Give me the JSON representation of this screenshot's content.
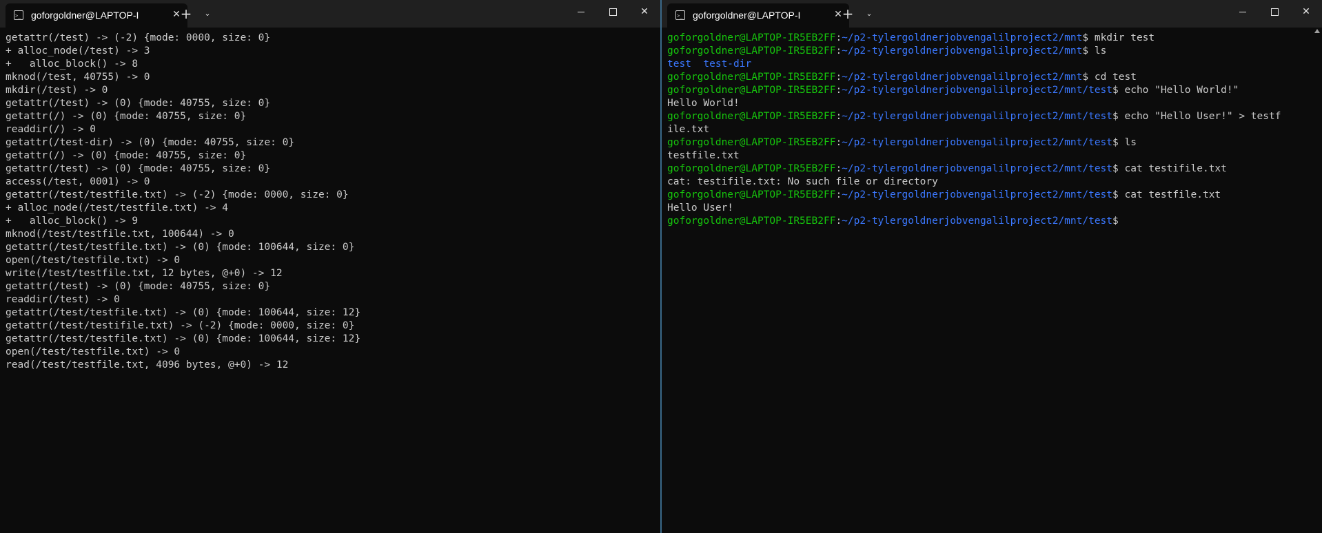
{
  "left_window": {
    "tab_title": "goforgoldner@LAPTOP-I",
    "lines": [
      "getattr(/test) -> (-2) {mode: 0000, size: 0}",
      "+ alloc_node(/test) -> 3",
      "+   alloc_block() -> 8",
      "mknod(/test, 40755) -> 0",
      "mkdir(/test) -> 0",
      "getattr(/test) -> (0) {mode: 40755, size: 0}",
      "getattr(/) -> (0) {mode: 40755, size: 0}",
      "readdir(/) -> 0",
      "getattr(/test-dir) -> (0) {mode: 40755, size: 0}",
      "getattr(/) -> (0) {mode: 40755, size: 0}",
      "getattr(/test) -> (0) {mode: 40755, size: 0}",
      "access(/test, 0001) -> 0",
      "getattr(/test/testfile.txt) -> (-2) {mode: 0000, size: 0}",
      "+ alloc_node(/test/testfile.txt) -> 4",
      "+   alloc_block() -> 9",
      "mknod(/test/testfile.txt, 100644) -> 0",
      "getattr(/test/testfile.txt) -> (0) {mode: 100644, size: 0}",
      "open(/test/testfile.txt) -> 0",
      "write(/test/testfile.txt, 12 bytes, @+0) -> 12",
      "getattr(/test) -> (0) {mode: 40755, size: 0}",
      "readdir(/test) -> 0",
      "getattr(/test/testfile.txt) -> (0) {mode: 100644, size: 12}",
      "getattr(/test/testifile.txt) -> (-2) {mode: 0000, size: 0}",
      "getattr(/test/testfile.txt) -> (0) {mode: 100644, size: 12}",
      "open(/test/testfile.txt) -> 0",
      "read(/test/testfile.txt, 4096 bytes, @+0) -> 12"
    ]
  },
  "right_window": {
    "tab_title": "goforgoldner@LAPTOP-I",
    "prompt_user": "goforgoldner@LAPTOP-IR5EB2FF",
    "lines": [
      {
        "type": "prompt",
        "path": "~/p2-tylergoldnerjobvengalilproject2/mnt",
        "cmd": " mkdir test"
      },
      {
        "type": "prompt",
        "path": "~/p2-tylergoldnerjobvengalilproject2/mnt",
        "cmd": " ls"
      },
      {
        "type": "dirs",
        "text": "test  test-dir"
      },
      {
        "type": "prompt",
        "path": "~/p2-tylergoldnerjobvengalilproject2/mnt",
        "cmd": " cd test"
      },
      {
        "type": "prompt",
        "path": "~/p2-tylergoldnerjobvengalilproject2/mnt/test",
        "cmd": " echo \"Hello World!\""
      },
      {
        "type": "out",
        "text": "Hello World!"
      },
      {
        "type": "prompt",
        "path": "~/p2-tylergoldnerjobvengalilproject2/mnt/test",
        "cmd": " echo \"Hello User!\" > testf"
      },
      {
        "type": "out",
        "text": "ile.txt"
      },
      {
        "type": "prompt",
        "path": "~/p2-tylergoldnerjobvengalilproject2/mnt/test",
        "cmd": " ls"
      },
      {
        "type": "out",
        "text": "testfile.txt"
      },
      {
        "type": "prompt",
        "path": "~/p2-tylergoldnerjobvengalilproject2/mnt/test",
        "cmd": " cat testifile.txt"
      },
      {
        "type": "out",
        "text": "cat: testifile.txt: No such file or directory"
      },
      {
        "type": "prompt",
        "path": "~/p2-tylergoldnerjobvengalilproject2/mnt/test",
        "cmd": " cat testfile.txt"
      },
      {
        "type": "out",
        "text": "Hello User!"
      },
      {
        "type": "prompt",
        "path": "~/p2-tylergoldnerjobvengalilproject2/mnt/test",
        "cmd": ""
      }
    ]
  },
  "colors": {
    "user": "#16c60c",
    "path": "#3b78ff",
    "text": "#cccccc",
    "background": "#0c0c0c",
    "titlebar": "#202020"
  },
  "icons": [
    "terminal-icon",
    "close-tab-icon",
    "plus-icon",
    "chevron-down-icon",
    "minimize-icon",
    "maximize-icon",
    "close-icon"
  ],
  "prompt_suffix": "$"
}
